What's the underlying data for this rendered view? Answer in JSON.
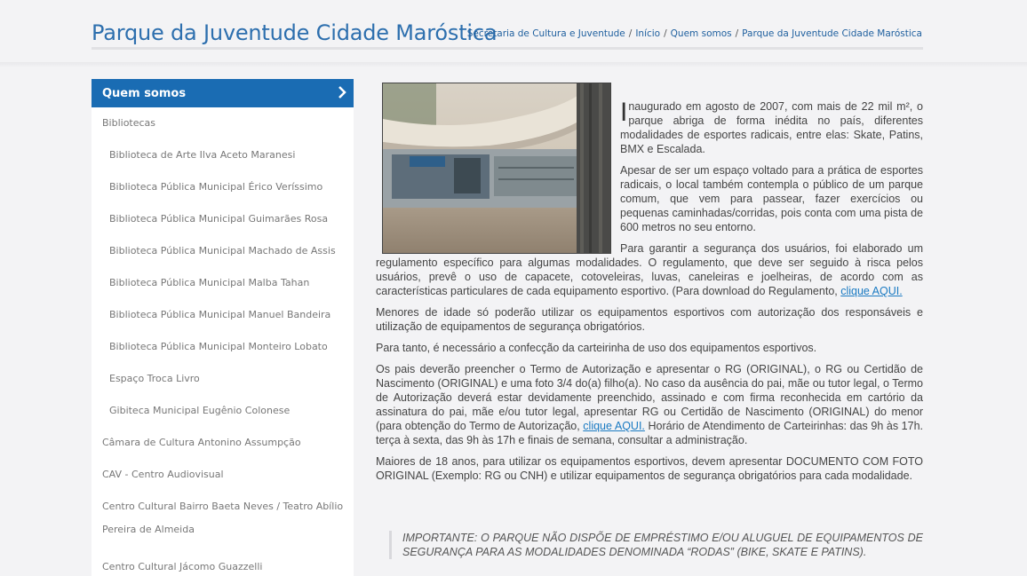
{
  "header": {
    "title": "Parque da Juventude Cidade Maróstica",
    "breadcrumb": [
      "Secretaria de Cultura e Juventude",
      "Início",
      "Quem somos",
      "Parque da Juventude Cidade Maróstica"
    ]
  },
  "sidebar": {
    "heading": "Quem somos",
    "items": [
      {
        "label": "Bibliotecas"
      },
      {
        "label": "Biblioteca de Arte Ilva Aceto Maranesi"
      },
      {
        "label": "Biblioteca Pública Municipal Érico Veríssimo"
      },
      {
        "label": "Biblioteca Pública Municipal Guimarães Rosa"
      },
      {
        "label": "Biblioteca Pública Municipal Machado de Assis"
      },
      {
        "label": "Biblioteca Pública Municipal Malba Tahan"
      },
      {
        "label": "Biblioteca Pública Municipal Manuel Bandeira"
      },
      {
        "label": "Biblioteca Pública Municipal Monteiro Lobato"
      },
      {
        "label": "Espaço Troca Livro"
      },
      {
        "label": "Gibiteca Municipal Eugênio Colonese"
      },
      {
        "label": "Câmara de Cultura Antonino Assumpção"
      },
      {
        "label": "CAV - Centro Audiovisual"
      },
      {
        "label": "Centro Cultural Bairro Baeta Neves / Teatro Abílio"
      },
      {
        "label": "Pereira de Almeida"
      },
      {
        "label": "Centro Cultural Jácomo Guazzelli"
      }
    ]
  },
  "article": {
    "p1_dropcap": "I",
    "p1": "naugurado em agosto de 2007, com mais de 22 mil m², o parque abriga de forma inédita no país, diferentes modalidades de esportes radicais, entre elas: Skate, Patins, BMX e Escalada.",
    "p2": "Apesar de ser um espaço voltado para a prática de esportes radicais, o local também contempla o público de um parque comum, que vem para passear, fazer exercícios ou pequenas caminhadas/corridas, pois conta com uma pista de 600 metros no seu entorno.",
    "p3_a": "Para garantir a segurança dos usuários, foi elaborado um regulamento específico para algumas modalidades. O regulamento, que deve ser seguido à risca pelos usuários, prevê o uso de capacete, cotoveleiras, luvas, caneleiras e joelheiras, de acordo com as características particulares de cada equipamento esportivo. (Para download do Regulamento, ",
    "p3_link": "clique AQUI.",
    "p4": "Menores de idade só poderão utilizar os equipamentos esportivos com autorização dos responsáveis e utilização de equipamentos de segurança obrigatórios.",
    "p5": "Para tanto, é necessário a confecção da carteirinha de uso dos equipamentos esportivos.",
    "p6_a": "Os pais deverão preencher o Termo de Autorização e apresentar o RG (ORIGINAL), o RG ou Certidão de Nascimento (ORIGINAL) e uma foto 3/4 do(a) filho(a). No caso da ausência do pai, mãe ou tutor legal, o Termo de Autorização deverá estar devidamente preenchido, assinado e com firma reconhecida em cartório da assinatura do pai, mãe e/ou tutor legal, apresentar RG ou Certidão de Nascimento (ORIGINAL) do menor (para obtenção do Termo de Autorização, ",
    "p6_link": "clique AQUI.",
    "p6_b": "  Horário de Atendimento de Carteirinhas: das 9h às 17h. terça à sexta, das 9h às 17h e finais de semana, consultar a administração.",
    "p7": "Maiores de 18 anos, para utilizar os equipamentos esportivos, devem apresentar DOCUMENTO COM FOTO ORIGINAL (Exemplo: RG ou CNH) e utilizar equipamentos de segurança obrigatórios para cada modalidade.",
    "notice": "IMPORTANTE: O PARQUE NÃO DISPÕE DE EMPRÉSTIMO E/OU ALUGUEL DE EQUIPAMENTOS DE SEGURANÇA PARA AS MODALIDADES DENOMINADA “RODAS” (BIKE, SKATE E PATINS)."
  },
  "colors": {
    "brand_blue": "#1a6cb3",
    "title_blue": "#2d6fae",
    "link_blue": "#1a7ac2"
  }
}
